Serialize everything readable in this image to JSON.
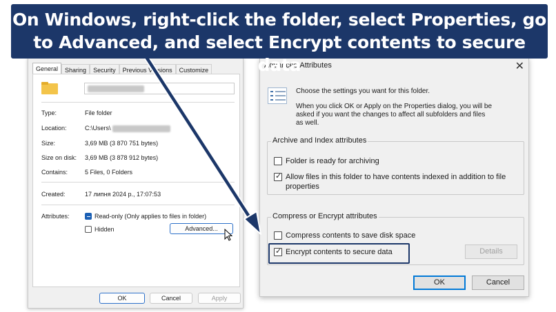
{
  "banner": {
    "line1": "On Windows, right-click the folder, select Properties, go",
    "line2": "to Advanced, and select Encrypt contents to secure data"
  },
  "properties": {
    "tabs": [
      "General",
      "Sharing",
      "Security",
      "Previous Versions",
      "Customize"
    ],
    "rows": [
      {
        "label": "Type:",
        "value": "File folder"
      },
      {
        "label": "Location:",
        "value": "C:\\Users\\"
      },
      {
        "label": "Size:",
        "value": "3,69 MB (3 870 751 bytes)"
      },
      {
        "label": "Size on disk:",
        "value": "3,69 MB (3 878 912 bytes)"
      },
      {
        "label": "Contains:",
        "value": "5 Files, 0 Folders"
      },
      {
        "label": "Created:",
        "value": "17 липня 2024 р., 17:07:53"
      }
    ],
    "attributes_label": "Attributes:",
    "readonly_label": "Read-only (Only applies to files in folder)",
    "hidden_label": "Hidden",
    "advanced_button": "Advanced...",
    "ok": "OK",
    "cancel": "Cancel",
    "apply": "Apply"
  },
  "advanced": {
    "title": "Advanced Attributes",
    "close": "✕",
    "desc1": "Choose the settings you want for this folder.",
    "desc2_line1": "When you click OK or Apply on the Properties dialog, you will be",
    "desc2_line2": "asked if you want the changes to affect all subfolders and files",
    "desc2_line3": "as well.",
    "archive_group": "Archive and Index attributes",
    "archive_cb": "Folder is ready for archiving",
    "index_cb_line1": "Allow files in this folder to have contents indexed in addition to file",
    "index_cb_line2": "properties",
    "compress_group": "Compress or Encrypt attributes",
    "compress_cb": "Compress contents to save disk space",
    "encrypt_cb": "Encrypt contents to secure data",
    "details": "Details",
    "ok": "OK",
    "cancel": "Cancel"
  },
  "colors": {
    "banner": "#1c3769",
    "accent": "#2b6fc9"
  }
}
